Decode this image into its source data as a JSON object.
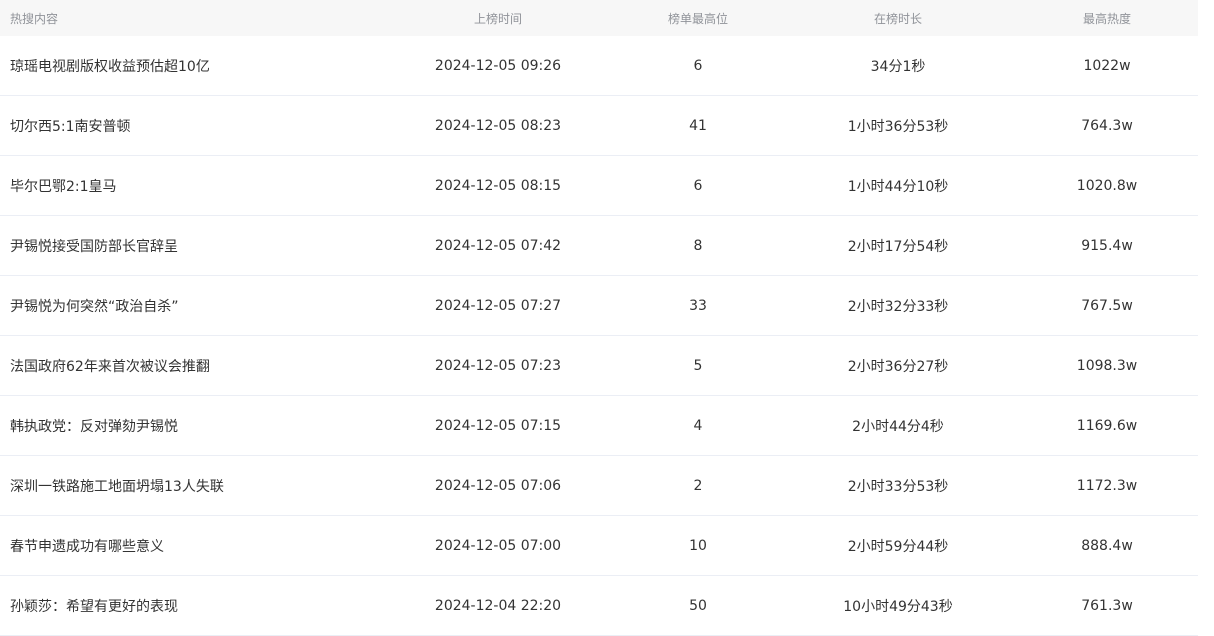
{
  "columns": {
    "title": "热搜内容",
    "time": "上榜时间",
    "rank": "榜单最高位",
    "duration": "在榜时长",
    "heat": "最高热度"
  },
  "rows": [
    {
      "title": "琼瑶电视剧版权收益预估超10亿",
      "time": "2024-12-05 09:26",
      "rank": "6",
      "duration": "34分1秒",
      "heat": "1022w"
    },
    {
      "title": "切尔西5:1南安普顿",
      "time": "2024-12-05 08:23",
      "rank": "41",
      "duration": "1小时36分53秒",
      "heat": "764.3w"
    },
    {
      "title": "毕尔巴鄂2:1皇马",
      "time": "2024-12-05 08:15",
      "rank": "6",
      "duration": "1小时44分10秒",
      "heat": "1020.8w"
    },
    {
      "title": "尹锡悦接受国防部长官辞呈",
      "time": "2024-12-05 07:42",
      "rank": "8",
      "duration": "2小时17分54秒",
      "heat": "915.4w"
    },
    {
      "title": "尹锡悦为何突然“政治自杀”",
      "time": "2024-12-05 07:27",
      "rank": "33",
      "duration": "2小时32分33秒",
      "heat": "767.5w"
    },
    {
      "title": "法国政府62年来首次被议会推翻",
      "time": "2024-12-05 07:23",
      "rank": "5",
      "duration": "2小时36分27秒",
      "heat": "1098.3w"
    },
    {
      "title": "韩执政党：反对弹劾尹锡悦",
      "time": "2024-12-05 07:15",
      "rank": "4",
      "duration": "2小时44分4秒",
      "heat": "1169.6w"
    },
    {
      "title": "深圳一铁路施工地面坍塌13人失联",
      "time": "2024-12-05 07:06",
      "rank": "2",
      "duration": "2小时33分53秒",
      "heat": "1172.3w"
    },
    {
      "title": "春节申遗成功有哪些意义",
      "time": "2024-12-05 07:00",
      "rank": "10",
      "duration": "2小时59分44秒",
      "heat": "888.4w"
    },
    {
      "title": "孙颖莎：希望有更好的表现",
      "time": "2024-12-04 22:20",
      "rank": "50",
      "duration": "10小时49分43秒",
      "heat": "761.3w"
    }
  ]
}
